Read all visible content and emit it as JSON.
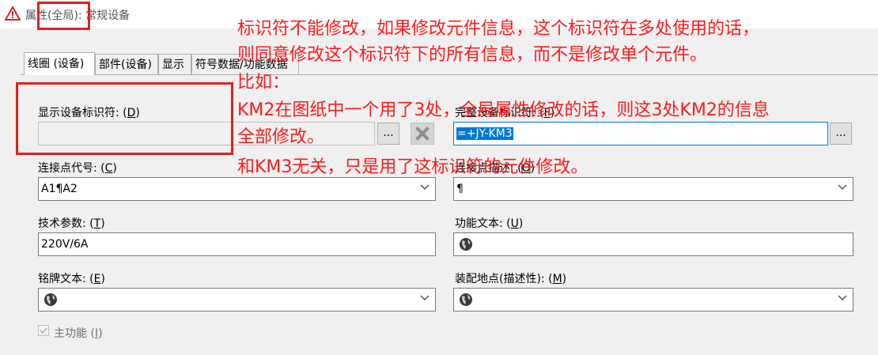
{
  "window": {
    "title": "属性(全局): 常规设备"
  },
  "tabs": [
    {
      "label": "线圈 (设备)",
      "active": true
    },
    {
      "label": "部件(设备)",
      "active": false
    },
    {
      "label": "显示",
      "active": false
    },
    {
      "label": "符号数据/功能数据",
      "active": false
    }
  ],
  "fields": {
    "show_identifier": {
      "label": "显示设备标识符: ",
      "hotkey": "D",
      "value": "",
      "more": "..."
    },
    "full_identifier": {
      "label": "完整设备标识符: ",
      "hotkey": "F",
      "value": "=+JY-KM3",
      "more": "..."
    },
    "connection_code": {
      "label": "连接点代号: ",
      "hotkey": "C",
      "value": "A1¶A2"
    },
    "connection_desc": {
      "label": "连接点描述: ",
      "hotkey": "O",
      "value": "¶"
    },
    "tech_params": {
      "label": "技术参数: ",
      "hotkey": "T",
      "value": "220V/6A"
    },
    "function_text": {
      "label": "功能文本: ",
      "hotkey": "U",
      "value": ""
    },
    "nameplate_text": {
      "label": "铭牌文本: ",
      "hotkey": "E",
      "value": ""
    },
    "install_location": {
      "label": "装配地点(描述性): ",
      "hotkey": "M",
      "value": ""
    },
    "main_function": {
      "label": "主功能 ",
      "hotkey": "I",
      "checked": true
    }
  },
  "annotation": {
    "lines": [
      "标识符不能修改，如果修改元件信息，这个标识符在多处使用的话，",
      "则同意修改这个标识符下的所有信息，而不是修改单个元件。",
      "比如：",
      "KM2在图纸中一个用了3处，全局属性修改的话，则这3处KM2的信息",
      "全部修改。",
      "和KM3无关，只是用了这标识符的元件修改。"
    ]
  },
  "colors": {
    "annotation": "#ff1a1a",
    "selection": "#0078d7"
  }
}
